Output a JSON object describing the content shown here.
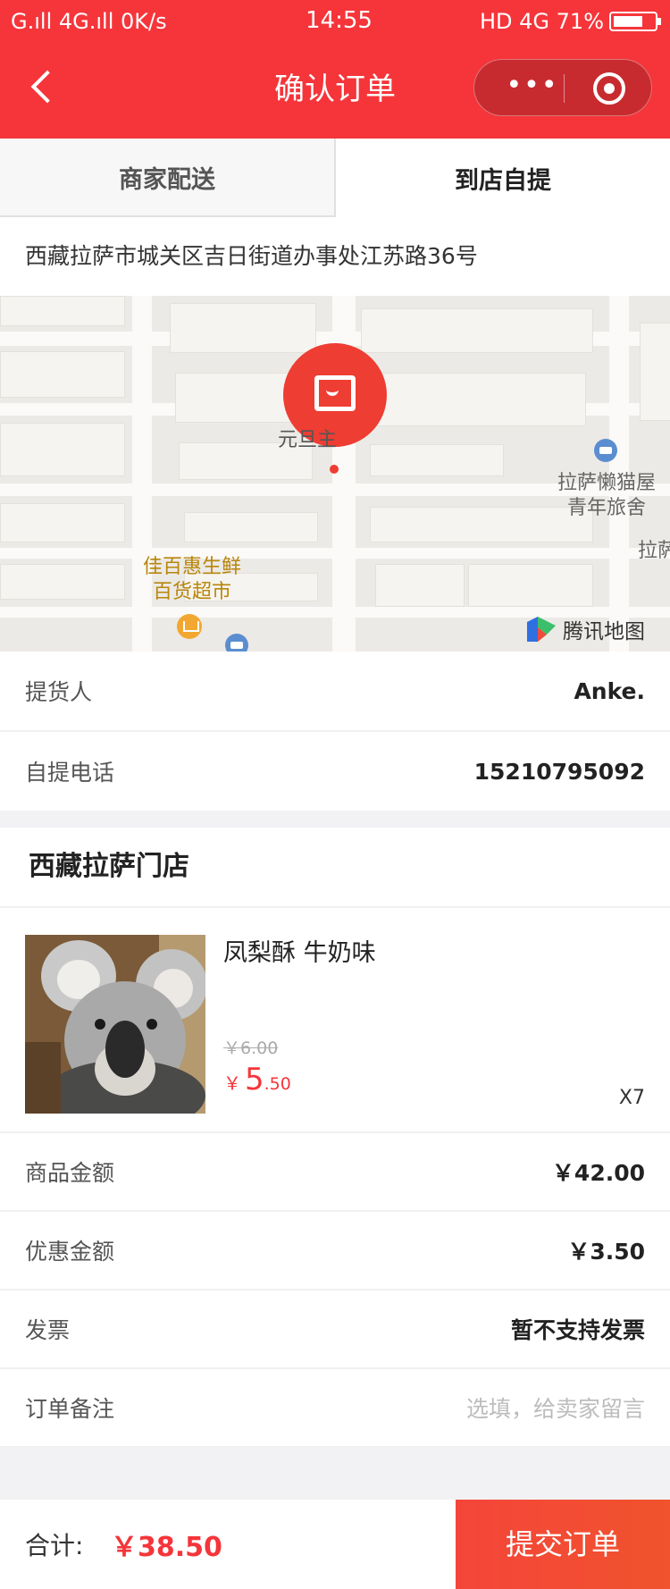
{
  "status_bar": {
    "left": "G.ıll 4G.ıll 0K/s",
    "time": "14:55",
    "right": "HD 4G 71%"
  },
  "navbar": {
    "title": "确认订单",
    "more_icon": "more-dots-icon",
    "close_icon": "target-circle-icon"
  },
  "tabs": [
    {
      "label": "商家配送",
      "active": false
    },
    {
      "label": "到店自提",
      "active": true
    }
  ],
  "address": "西藏拉萨市城关区吉日街道办事处江苏路36号",
  "map": {
    "marker_label": "元旦主",
    "poi_hotel": "拉萨懒猫屋\n青年旅舍",
    "poi_hotel_line1": "拉萨懒猫屋",
    "poi_hotel_line2": "青年旅舍",
    "poi_market_line1": "佳百惠生鲜",
    "poi_market_line2": "百货超市",
    "edge_label": "拉萨",
    "provider": "腾讯地图",
    "label_color": "#b8860b"
  },
  "pickup": {
    "person_label": "提货人",
    "person_value": "Anke.",
    "phone_label": "自提电话",
    "phone_value": "15210795092"
  },
  "store_name": "西藏拉萨门店",
  "product": {
    "name": "凤梨酥 牛奶味",
    "original_price": "￥6.00",
    "currency": "￥",
    "price_int": "5",
    "price_dec": ".50",
    "quantity": "X7"
  },
  "summary": {
    "goods_label": "商品金额",
    "goods_value": "￥42.00",
    "discount_label": "优惠金额",
    "discount_value": "￥3.50",
    "invoice_label": "发票",
    "invoice_value": "暂不支持发票",
    "remark_label": "订单备注",
    "remark_placeholder": "选填，给卖家留言"
  },
  "footer": {
    "total_label": "合计:",
    "total_value": "￥38.50",
    "submit_label": "提交订单"
  },
  "colors": {
    "brand": "#f5353a",
    "price": "#f5353a"
  }
}
